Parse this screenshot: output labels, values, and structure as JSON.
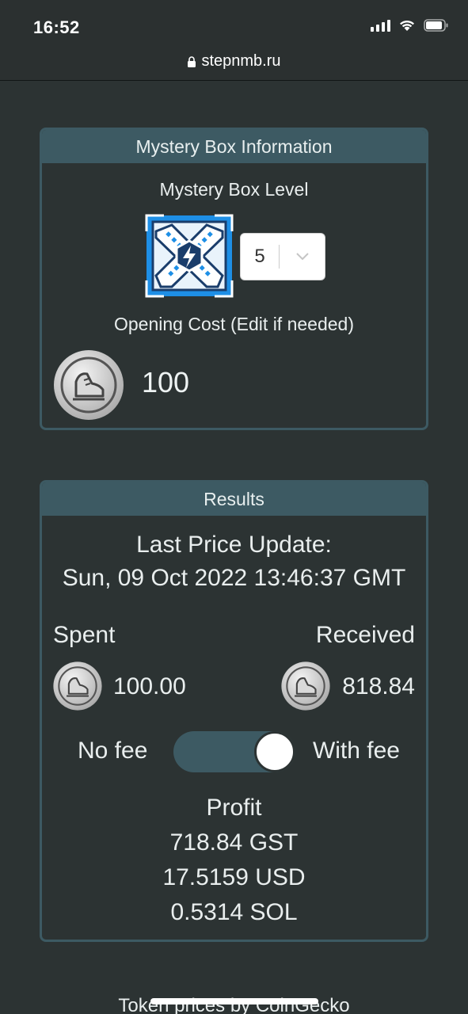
{
  "status_bar": {
    "time": "16:52"
  },
  "browser": {
    "url": "stepnmb.ru"
  },
  "mystery_box": {
    "header": "Mystery Box Information",
    "level_label": "Mystery Box Level",
    "level_value": "5",
    "cost_label": "Opening Cost (Edit if needed)",
    "cost_value": "100"
  },
  "results": {
    "header": "Results",
    "last_update_label": "Last Price Update:",
    "last_update_value": "Sun, 09 Oct 2022 13:46:37 GMT",
    "spent_label": "Spent",
    "received_label": "Received",
    "spent_value": "100.00",
    "received_value": "818.84",
    "no_fee_label": "No fee",
    "with_fee_label": "With fee",
    "fee_toggle_on": true,
    "profit_label": "Profit",
    "profit_gst": "718.84 GST",
    "profit_usd": "17.5159 USD",
    "profit_sol": "0.5314 SOL"
  },
  "footer": {
    "text": "Token prices by CoinGecko"
  },
  "icons": {
    "mystery_box": "mystery-box-icon",
    "token": "gst-coin-icon"
  },
  "colors": {
    "background": "#2c3333",
    "accent": "#3d5a63",
    "mystery_box_blue": "#1e8fe6"
  }
}
